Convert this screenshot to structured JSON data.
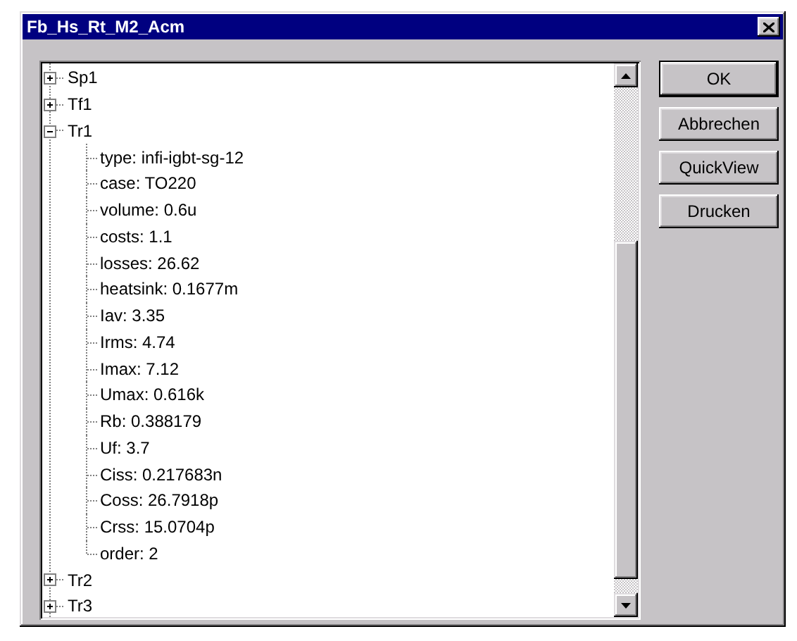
{
  "window": {
    "title": "Fb_Hs_Rt_M2_Acm"
  },
  "tree": [
    {
      "label": "Sp1",
      "expanded": false
    },
    {
      "label": "Tf1",
      "expanded": false
    },
    {
      "label": "Tr1",
      "expanded": true,
      "children": [
        {
          "label": "type: infi-igbt-sg-12"
        },
        {
          "label": "case: TO220"
        },
        {
          "label": "volume: 0.6u"
        },
        {
          "label": "costs: 1.1"
        },
        {
          "label": "losses: 26.62"
        },
        {
          "label": "heatsink: 0.1677m"
        },
        {
          "label": "Iav: 3.35"
        },
        {
          "label": "Irms: 4.74"
        },
        {
          "label": "Imax: 7.12"
        },
        {
          "label": "Umax: 0.616k"
        },
        {
          "label": "Rb: 0.388179"
        },
        {
          "label": "Uf: 3.7"
        },
        {
          "label": "Ciss: 0.217683n"
        },
        {
          "label": "Coss: 26.7918p"
        },
        {
          "label": "Crss: 15.0704p"
        },
        {
          "label": "order: 2"
        }
      ]
    },
    {
      "label": "Tr2",
      "expanded": false
    },
    {
      "label": "Tr3",
      "expanded": false
    }
  ],
  "buttons": [
    {
      "label": "OK",
      "default": true
    },
    {
      "label": "Abbrechen",
      "default": false
    },
    {
      "label": "QuickView",
      "default": false
    },
    {
      "label": "Drucken",
      "default": false
    }
  ]
}
